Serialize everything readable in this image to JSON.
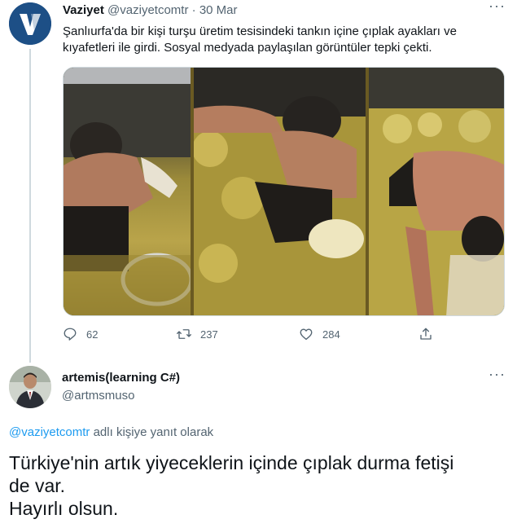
{
  "quoted_tweet": {
    "display_name": "Vaziyet",
    "handle": "@vaziyetcomtr",
    "separator": "·",
    "date": "30 Mar",
    "text": "Şanlıurfa'da bir kişi turşu üretim tesisindeki tankın içine çıplak ayakları ve kıyafetleri ile girdi. Sosyal medyada paylaşılan görüntüler tepki çekti.",
    "more": "···",
    "avatar_letter": "V",
    "stats": {
      "replies": "62",
      "retweets": "237",
      "likes": "284"
    }
  },
  "reply_tweet": {
    "display_name": "artemis(learning C#)",
    "handle": "@artmsmuso",
    "more": "···",
    "replying_to_mention": "@vaziyetcomtr",
    "replying_to_suffix": " adlı kişiye yanıt olarak",
    "text_lines": [
      "Türkiye'nin artık yiyeceklerin içinde çıplak durma fetişi",
      "de var.",
      "Hayırlı olsun."
    ]
  },
  "icons": [
    "reply-icon",
    "retweet-icon",
    "like-icon",
    "share-icon",
    "more-icon"
  ],
  "colors": {
    "text": "#0f1419",
    "secondary": "#536471",
    "link": "#1d9bf0",
    "thread_line": "#cfd9de",
    "vaziyet_brand": "#1d4f86"
  }
}
